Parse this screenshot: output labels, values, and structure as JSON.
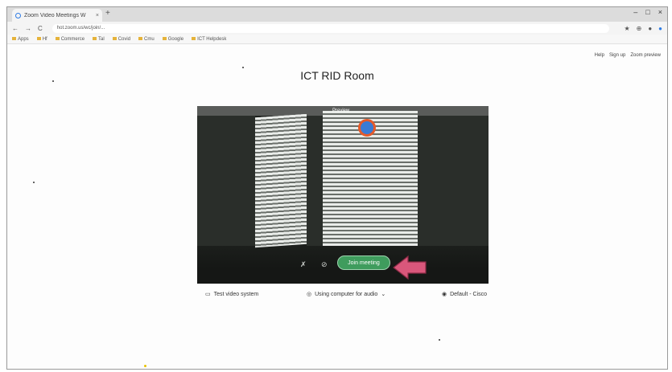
{
  "browser": {
    "tab_title": "Zoom Video Meetings W",
    "new_tab": "+",
    "window_controls": [
      "–",
      "□",
      "×"
    ],
    "nav": [
      "←",
      "→",
      "C"
    ],
    "url": "hot.zoom.us/wc/join/...",
    "extensions": [
      "★",
      "⊕",
      "●",
      "●"
    ],
    "bookmarks": [
      "Apps",
      "Hf",
      "Commerce",
      "Tal",
      "Covid",
      "Cmu",
      "Google",
      "ICT Helpdesk"
    ]
  },
  "page": {
    "top_links": [
      "Help",
      "Sign up",
      "Zoom preview"
    ],
    "room_title": "ICT RID Room",
    "preview_label": "Preview",
    "join_label": "Join meeting",
    "controls": {
      "left": "Test video system",
      "mid": "Using computer for audio",
      "right": "Default - Cisco"
    }
  },
  "colors": {
    "join_green": "#3f9c5d",
    "arrow_pink": "#d9577b",
    "zoom_blue": "#2d7be5"
  }
}
